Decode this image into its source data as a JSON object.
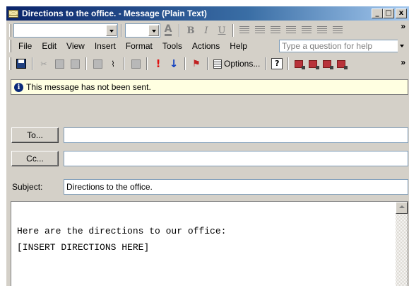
{
  "window": {
    "title": "Directions to the office. - Message (Plain Text)",
    "buttons": {
      "minimize": "_",
      "maximize": "□",
      "close": "x"
    }
  },
  "format_toolbar": {
    "font_value": "",
    "size_value": "",
    "bold": "B",
    "italic": "I",
    "underline": "U",
    "overflow": "»"
  },
  "menu": {
    "items": [
      "File",
      "Edit",
      "View",
      "Insert",
      "Format",
      "Tools",
      "Actions",
      "Help"
    ],
    "help_placeholder": "Type a question for help"
  },
  "standard_toolbar": {
    "options_label": "Options...",
    "help_icon": "?",
    "overflow": "»",
    "icons": [
      "save-icon",
      "cut-icon",
      "copy-icon",
      "paste-icon",
      "print-preview-icon",
      "attach-icon",
      "address-book-icon",
      "high-importance-icon",
      "low-importance-icon",
      "flag-icon",
      "options-icon",
      "help-icon",
      "permission-icon"
    ]
  },
  "infobar": {
    "text": "This message has not been sent."
  },
  "fields": {
    "to_label": "To...",
    "to_value": "",
    "cc_label": "Cc...",
    "cc_value": "",
    "subject_label": "Subject:",
    "subject_value": "Directions to the office."
  },
  "body": {
    "line1": "Here are the directions to our office:",
    "line2": "[INSERT DIRECTIONS HERE]"
  }
}
